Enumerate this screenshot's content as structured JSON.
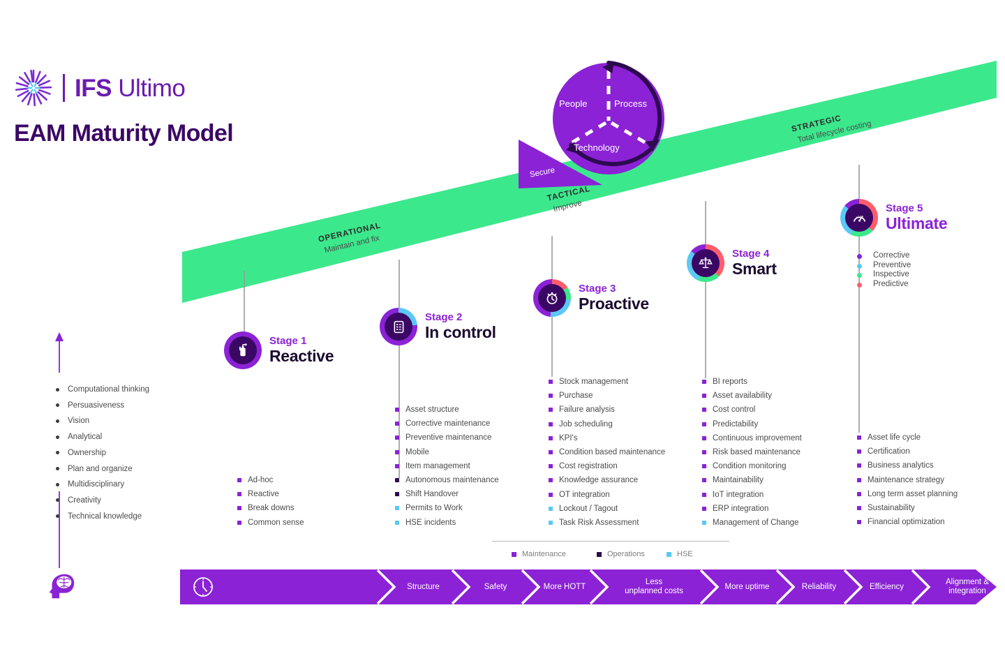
{
  "brand": {
    "prefix": "IFS",
    "suffix": "Ultimo",
    "logo_icon": "ifs-spiral-logo"
  },
  "page_title": "EAM Maturity Model",
  "colors": {
    "brand_purple": "#6a1bb0",
    "accent_violet": "#8b22d6",
    "deep_purple": "#3b0764",
    "ramp_green": "#3ce88c",
    "hse_blue": "#5bc8f5",
    "operations": "#2d0a50",
    "predictive_red": "#ff5c6c"
  },
  "cycle": {
    "segments": [
      "People",
      "Process",
      "Technology"
    ],
    "chock_label": "Secure"
  },
  "ramp_labels": [
    {
      "title": "OPERATIONAL",
      "subtitle": "Maintain and fix"
    },
    {
      "title": "TACTICAL",
      "subtitle": "Improve"
    },
    {
      "title": "STRATEGIC",
      "subtitle": "Total lifecycle costing"
    }
  ],
  "stages": [
    {
      "number": "Stage 1",
      "name": "Reactive",
      "icon": "fire-extinguisher-icon",
      "items": [
        {
          "label": "Ad-hoc",
          "cat": "maintenance"
        },
        {
          "label": "Reactive",
          "cat": "maintenance"
        },
        {
          "label": "Break downs",
          "cat": "maintenance"
        },
        {
          "label": "Common sense",
          "cat": "maintenance"
        }
      ]
    },
    {
      "number": "Stage 2",
      "name": "In control",
      "icon": "clipboard-checklist-icon",
      "items": [
        {
          "label": "Asset structure",
          "cat": "maintenance"
        },
        {
          "label": "Corrective maintenance",
          "cat": "maintenance"
        },
        {
          "label": "Preventive maintenance",
          "cat": "maintenance"
        },
        {
          "label": "Mobile",
          "cat": "maintenance"
        },
        {
          "label": "Item management",
          "cat": "maintenance"
        },
        {
          "label": "Autonomous maintenance",
          "cat": "operations"
        },
        {
          "label": "Shift Handover",
          "cat": "operations"
        },
        {
          "label": "Permits to Work",
          "cat": "hse"
        },
        {
          "label": "HSE incidents",
          "cat": "hse"
        }
      ]
    },
    {
      "number": "Stage 3",
      "name": "Proactive",
      "icon": "alarm-clock-icon",
      "items": [
        {
          "label": "Stock management",
          "cat": "maintenance"
        },
        {
          "label": "Purchase",
          "cat": "maintenance"
        },
        {
          "label": "Failure analysis",
          "cat": "maintenance"
        },
        {
          "label": "Job scheduling",
          "cat": "maintenance"
        },
        {
          "label": "KPI's",
          "cat": "maintenance"
        },
        {
          "label": "Condition based maintenance",
          "cat": "maintenance"
        },
        {
          "label": "Cost registration",
          "cat": "maintenance"
        },
        {
          "label": "Knowledge assurance",
          "cat": "maintenance"
        },
        {
          "label": "OT integration",
          "cat": "maintenance"
        },
        {
          "label": "Lockout / Tagout",
          "cat": "hse"
        },
        {
          "label": "Task Risk Assessment",
          "cat": "hse"
        }
      ]
    },
    {
      "number": "Stage 4",
      "name": "Smart",
      "icon": "balance-scales-icon",
      "items": [
        {
          "label": "BI reports",
          "cat": "maintenance"
        },
        {
          "label": "Asset availability",
          "cat": "maintenance"
        },
        {
          "label": "Cost control",
          "cat": "maintenance"
        },
        {
          "label": "Predictability",
          "cat": "maintenance"
        },
        {
          "label": "Continuous improvement",
          "cat": "maintenance"
        },
        {
          "label": "Risk based maintenance",
          "cat": "maintenance"
        },
        {
          "label": "Condition monitoring",
          "cat": "maintenance"
        },
        {
          "label": "Maintainability",
          "cat": "maintenance"
        },
        {
          "label": "IoT integration",
          "cat": "maintenance"
        },
        {
          "label": "ERP integration",
          "cat": "maintenance"
        },
        {
          "label": "Management of Change",
          "cat": "hse"
        }
      ]
    },
    {
      "number": "Stage 5",
      "name": "Ultimate",
      "icon": "speedometer-gauge-icon",
      "items": [
        {
          "label": "Asset life cycle",
          "cat": "maintenance"
        },
        {
          "label": "Certification",
          "cat": "maintenance"
        },
        {
          "label": "Business analytics",
          "cat": "maintenance"
        },
        {
          "label": "Maintenance strategy",
          "cat": "maintenance"
        },
        {
          "label": "Long term asset planning",
          "cat": "maintenance"
        },
        {
          "label": "Sustainability",
          "cat": "maintenance"
        },
        {
          "label": "Financial optimization",
          "cat": "maintenance"
        }
      ]
    }
  ],
  "stage5_legend": [
    {
      "label": "Corrective",
      "color": "#8b22d6"
    },
    {
      "label": "Preventive",
      "color": "#5bc8f5"
    },
    {
      "label": "Inspective",
      "color": "#3ce88c"
    },
    {
      "label": "Predictive",
      "color": "#ff5c6c"
    }
  ],
  "skills": {
    "icon": "head-with-brain-icon",
    "arrow_icon": "up-arrow-icon",
    "items": [
      "Computational thinking",
      "Persuasiveness",
      "Vision",
      "Analytical",
      "Ownership",
      "Plan and organize",
      "Multidisciplinary",
      "Creativity",
      "Technical knowledge"
    ]
  },
  "legend": [
    {
      "label": "Maintenance",
      "color": "#8b22d6"
    },
    {
      "label": "Operations",
      "color": "#2d0a50"
    },
    {
      "label": "HSE",
      "color": "#5bc8f5"
    }
  ],
  "benefit_bar": {
    "icon": "clock-icon",
    "steps": [
      "Structure",
      "Safety",
      "More HOTT",
      "Less\nunplanned costs",
      "More uptime",
      "Reliability",
      "Efficiency",
      "Alignment &\nintegration"
    ]
  }
}
